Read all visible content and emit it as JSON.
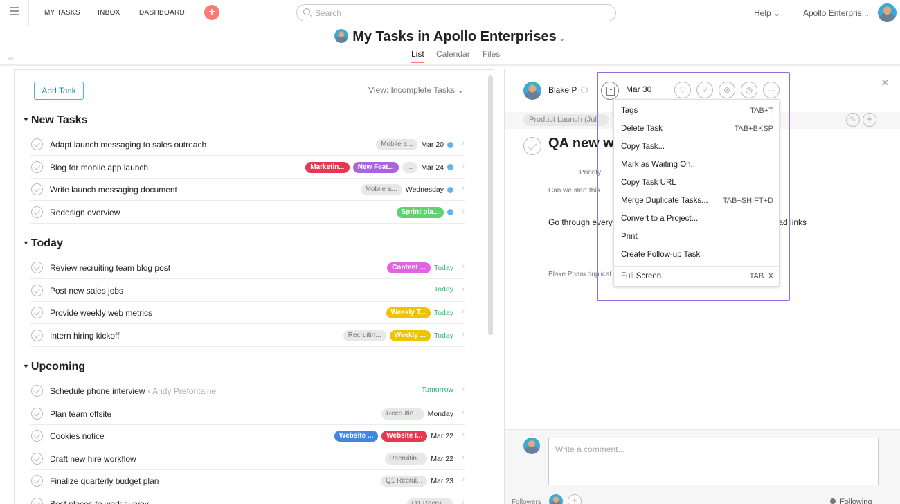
{
  "topbar": {
    "nav": [
      "MY TASKS",
      "INBOX",
      "DASHBOARD"
    ],
    "search_placeholder": "Search",
    "help": "Help ⌄",
    "org": "Apollo Enterpris..."
  },
  "header": {
    "title": "My Tasks in Apollo Enterprises",
    "tabs": [
      "List",
      "Calendar",
      "Files"
    ]
  },
  "list": {
    "add_task": "Add Task",
    "view_filter": "View: Incomplete Tasks ⌄",
    "sections": [
      {
        "title": "New Tasks",
        "tasks": [
          {
            "name": "Adapt launch messaging to sales outreach",
            "tags": [
              {
                "label": "Mobile a...",
                "color": "#e8e8e8"
              }
            ],
            "due": "Mar 20",
            "due_color": "#222222",
            "dot": true
          },
          {
            "name": "Blog for mobile app launch",
            "tags": [
              {
                "label": "Marketin...",
                "color": "#e8384f"
              },
              {
                "label": "New Feat...",
                "color": "#aa62e3"
              },
              {
                "label": "...",
                "color": "#e8e8e8"
              }
            ],
            "due": "Mar 24",
            "due_color": "#222222",
            "dot": true
          },
          {
            "name": "Write launch messaging document",
            "tags": [
              {
                "label": "Mobile a...",
                "color": "#e8e8e8"
              }
            ],
            "due": "Wednesday",
            "due_color": "#222222",
            "dot": true
          },
          {
            "name": "Redesign overview",
            "tags": [
              {
                "label": "Sprint pla...",
                "color": "#62d26f"
              }
            ],
            "due": "",
            "due_color": "#222222",
            "dot": true
          }
        ]
      },
      {
        "title": "Today",
        "tasks": [
          {
            "name": "Review recruiting team blog post",
            "tags": [
              {
                "label": "Content ...",
                "color": "#e362e3"
              }
            ],
            "due": "Today",
            "due_color": "#26b470",
            "dot": false
          },
          {
            "name": "Post new sales jobs",
            "tags": [],
            "due": "Today",
            "due_color": "#26b470",
            "dot": false
          },
          {
            "name": "Provide weekly web metrics",
            "tags": [
              {
                "label": "Weekly T...",
                "color": "#eec300"
              }
            ],
            "due": "Today",
            "due_color": "#26b470",
            "dot": false
          },
          {
            "name": "Intern hiring kickoff",
            "tags": [
              {
                "label": "Recruitin...",
                "color": "#e8e8e8"
              },
              {
                "label": "Weekly ...",
                "color": "#eec300"
              }
            ],
            "due": "Today",
            "due_color": "#26b470",
            "dot": false
          }
        ]
      },
      {
        "title": "Upcoming",
        "tasks": [
          {
            "name": "Schedule phone interview",
            "assignee": "‹ Andy Prefontaine",
            "tags": [],
            "due": "Tomorrow",
            "due_color": "#26b470",
            "dot": false
          },
          {
            "name": "Plan team offsite",
            "tags": [
              {
                "label": "Recruitin...",
                "color": "#e8e8e8"
              }
            ],
            "due": "Monday",
            "due_color": "#222222",
            "dot": false
          },
          {
            "name": "Cookies notice",
            "tags": [
              {
                "label": "Website ...",
                "color": "#4186e0"
              },
              {
                "label": "Website I...",
                "color": "#e8384f"
              }
            ],
            "due": "Mar 22",
            "due_color": "#222222",
            "dot": false
          },
          {
            "name": "Draft new hire workflow",
            "tags": [
              {
                "label": "Recruitin...",
                "color": "#e8e8e8"
              }
            ],
            "due": "Mar 22",
            "due_color": "#222222",
            "dot": false
          },
          {
            "name": "Finalize quarterly budget plan",
            "tags": [
              {
                "label": "Q1 Recrui...",
                "color": "#e8e8e8"
              }
            ],
            "due": "Mar 23",
            "due_color": "#222222",
            "dot": false
          },
          {
            "name": "Best places to work survey",
            "tags": [
              {
                "label": "Q1 Recrui...",
                "color": "#e8e8e8"
              }
            ],
            "due": "",
            "due_color": "#222222",
            "dot": false
          }
        ]
      }
    ]
  },
  "detail": {
    "assignee": "Blake P",
    "due": "Mar 30",
    "project": "Product Launch (Jul...",
    "title": "QA new w",
    "priority_label": "Priority",
    "question": "Can we start this",
    "description": "Go through every",
    "description_tail": "dead links",
    "activity": "Blake Pham duplicat",
    "comment_placeholder": "Write a comment...",
    "followers_label": "Followers",
    "following_label": "Following"
  },
  "menu": {
    "items": [
      {
        "label": "Tags",
        "shortcut": "TAB+T"
      },
      {
        "label": "Delete Task",
        "shortcut": "TAB+BKSP"
      },
      {
        "label": "Copy Task...",
        "shortcut": ""
      },
      {
        "label": "Mark as Waiting On...",
        "shortcut": ""
      },
      {
        "label": "Copy Task URL",
        "shortcut": ""
      },
      {
        "label": "Merge Duplicate Tasks...",
        "shortcut": "TAB+SHIFT+D"
      },
      {
        "label": "Convert to a Project...",
        "shortcut": ""
      },
      {
        "label": "Print",
        "shortcut": ""
      },
      {
        "label": "Create Follow-up Task",
        "shortcut": ""
      },
      {
        "label": "Full Screen",
        "shortcut": "TAB+X"
      }
    ]
  }
}
